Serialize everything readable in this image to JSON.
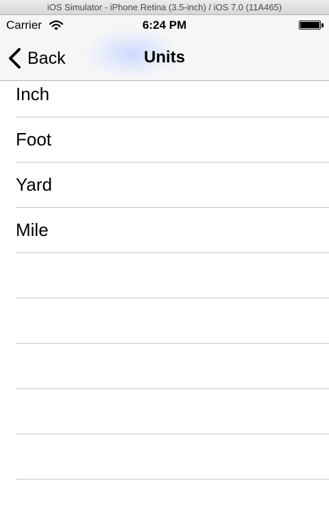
{
  "window": {
    "title": "iOS Simulator - iPhone Retina (3.5-inch) / iOS 7.0 (11A465)"
  },
  "status_bar": {
    "carrier": "Carrier",
    "time": "6:24 PM",
    "wifi_icon": "wifi-icon",
    "battery_icon": "battery-icon"
  },
  "nav": {
    "back_label": "Back",
    "back_icon": "chevron-left-icon",
    "title": "Units"
  },
  "list": {
    "items": [
      {
        "label": "Inch"
      },
      {
        "label": "Foot"
      },
      {
        "label": "Yard"
      },
      {
        "label": "Mile"
      }
    ]
  },
  "colors": {
    "separator": "#c8c7cc",
    "nav_background": "#f6f6f7",
    "text": "#000000"
  }
}
